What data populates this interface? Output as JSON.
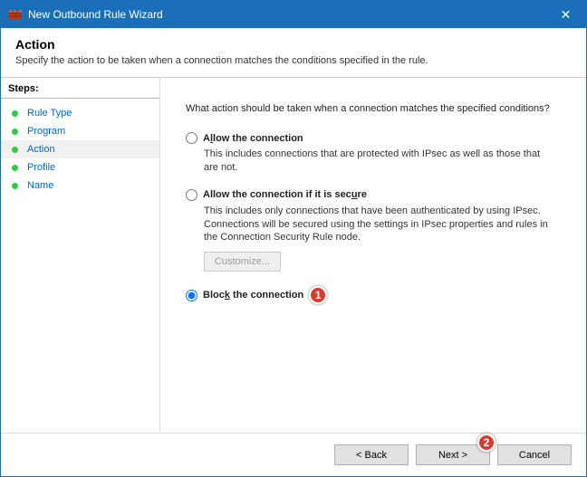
{
  "titlebar": {
    "title": "New Outbound Rule Wizard",
    "close_glyph": "✕"
  },
  "header": {
    "title": "Action",
    "subtitle": "Specify the action to be taken when a connection matches the conditions specified in the rule."
  },
  "sidebar": {
    "steps_label": "Steps:",
    "items": [
      {
        "label": "Rule Type",
        "selected": false
      },
      {
        "label": "Program",
        "selected": false
      },
      {
        "label": "Action",
        "selected": true
      },
      {
        "label": "Profile",
        "selected": false
      },
      {
        "label": "Name",
        "selected": false
      }
    ]
  },
  "content": {
    "question": "What action should be taken when a connection matches the specified conditions?",
    "options": [
      {
        "label_pre": "A",
        "label_u": "l",
        "label_post": "low the connection",
        "desc": "This includes connections that are protected with IPsec as well as those that are not.",
        "checked": false,
        "has_customize": false
      },
      {
        "label_pre": "Allow the connection if it is sec",
        "label_u": "u",
        "label_post": "re",
        "desc": "This includes only connections that have been authenticated by using IPsec. Connections will be secured using the settings in IPsec properties and rules in the Connection Security Rule node.",
        "checked": false,
        "has_customize": true,
        "customize_label": "Customize..."
      },
      {
        "label_pre": "Bloc",
        "label_u": "k",
        "label_post": " the connection",
        "desc": "",
        "checked": true,
        "has_customize": false
      }
    ]
  },
  "callouts": {
    "one": "1",
    "two": "2"
  },
  "footer": {
    "back": "< Back",
    "next": "Next >",
    "cancel": "Cancel"
  }
}
